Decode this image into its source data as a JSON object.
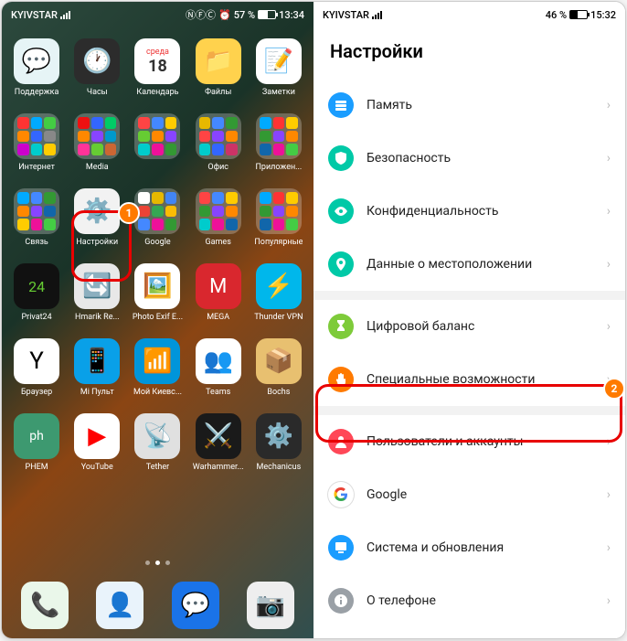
{
  "left": {
    "status": {
      "carrier": "KYIVSTAR",
      "battery_pct": "57 %",
      "time": "13:34",
      "batfill": "57%"
    },
    "apps": [
      {
        "label": "Поддержка",
        "bg": "#e6f4f6",
        "emoji": "💬",
        "fg": "#3ab"
      },
      {
        "label": "Часы",
        "bg": "#2c2c2c",
        "emoji": "🕐"
      },
      {
        "label": "Календарь",
        "type": "cal",
        "day": "18",
        "weekday": "среда"
      },
      {
        "label": "Файлы",
        "bg": "#ffd24d",
        "emoji": "📁"
      },
      {
        "label": "Заметки",
        "bg": "#fff",
        "emoji": "📝",
        "fg": "#f4c430"
      },
      {
        "label": "Интернет",
        "type": "folder",
        "c": [
          "#f33",
          "#0af",
          "#4c4",
          "#f80",
          "#36f",
          "#888",
          "#c0c",
          "#0cc",
          "#fc0"
        ]
      },
      {
        "label": "Media",
        "type": "folder",
        "c": [
          "#e11",
          "#36f",
          "#0c6",
          "#f80",
          "#84f",
          "#09c",
          "#f39",
          "#6c3",
          "#c63"
        ]
      },
      {
        "label": "",
        "type": "folder",
        "c": [
          "#f44",
          "#48f",
          "#fc0",
          "#6c3",
          "#f80",
          "#84f",
          "#0cc",
          "#e19",
          "#393"
        ]
      },
      {
        "label": "Офис",
        "type": "folder",
        "c": [
          "#e6b800",
          "#48f",
          "#393",
          "#f44",
          "#84f",
          "#f80",
          "#0cc",
          "#36f",
          "#c36"
        ]
      },
      {
        "label": "Приложен...",
        "type": "folder",
        "c": [
          "#0af",
          "#f33",
          "#fc0",
          "#393",
          "#84f",
          "#f80",
          "#16a",
          "#e19",
          "#4c4"
        ]
      },
      {
        "label": "Связь",
        "type": "folder",
        "c": [
          "#0af",
          "#48f",
          "#393",
          "#f80",
          "#84f",
          "#16a",
          "#fc0",
          "#e19",
          "#4c4"
        ]
      },
      {
        "label": "Настройки",
        "bg": "#f2f2f2",
        "emoji": "⚙️",
        "fg": "#888"
      },
      {
        "label": "Google",
        "type": "folder",
        "c": [
          "#fff",
          "#e6b800",
          "#4285f4",
          "#ea4335",
          "#34a853",
          "#fbbc05",
          "#48f",
          "#e19",
          "#393"
        ]
      },
      {
        "label": "Games",
        "type": "folder",
        "c": [
          "#f44",
          "#48f",
          "#fc0",
          "#393",
          "#84f",
          "#f80",
          "#0cc",
          "#e19",
          "#16a"
        ]
      },
      {
        "label": "Популярные",
        "type": "folder",
        "c": [
          "#0af",
          "#f33",
          "#fc0",
          "#393",
          "#84f",
          "#f80",
          "#16a",
          "#e19",
          "#4c4"
        ]
      },
      {
        "label": "Privat24",
        "bg": "#111",
        "emoji": "24",
        "fg": "#6c3",
        "fs": "16px"
      },
      {
        "label": "Hmarik Re...",
        "bg": "#e8e8e8",
        "emoji": "🔄",
        "fg": "#e80"
      },
      {
        "label": "Photo Exif E...",
        "bg": "#fff",
        "emoji": "🖼️"
      },
      {
        "label": "MEGA",
        "bg": "#d9272e",
        "emoji": "M",
        "fs": "22px"
      },
      {
        "label": "Thunder VPN",
        "bg": "#00b7eb",
        "emoji": "⚡"
      },
      {
        "label": "Браузер",
        "bg": "#fff",
        "emoji": "Y",
        "fg": "#000",
        "fs": "26px"
      },
      {
        "label": "Mi Пульт",
        "bg": "#09a0e8",
        "emoji": "📱"
      },
      {
        "label": "Мой Киевс...",
        "bg": "#0095da",
        "emoji": "📶"
      },
      {
        "label": "Teams",
        "bg": "#fff",
        "emoji": "👥",
        "fg": "#5059c9"
      },
      {
        "label": "Bochs",
        "bg": "#e8c070",
        "emoji": "📦"
      },
      {
        "label": "PHEM",
        "bg": "#3d9970",
        "emoji": "ph",
        "fs": "14px"
      },
      {
        "label": "YouTube",
        "bg": "#fff",
        "emoji": "▶",
        "fg": "#f00"
      },
      {
        "label": "Tether",
        "bg": "#e0e0e0",
        "emoji": "📡",
        "fg": "#11a"
      },
      {
        "label": "Warhammer...",
        "bg": "#1a1a1a",
        "emoji": "⚔️"
      },
      {
        "label": "Mechanicus",
        "bg": "#2a2a2a",
        "emoji": "⚙️",
        "fg": "#c96"
      }
    ],
    "dock": [
      {
        "bg": "#eaf7ea",
        "emoji": "📞",
        "fg": "#4caf50"
      },
      {
        "bg": "#e9f3fb",
        "emoji": "👤",
        "fg": "#2196f3"
      },
      {
        "bg": "#1a73e8",
        "emoji": "💬"
      },
      {
        "bg": "#eee",
        "emoji": "📷",
        "fg": "#555"
      }
    ]
  },
  "right": {
    "status": {
      "carrier": "KYIVSTAR",
      "battery_pct": "46 %",
      "time": "15:32",
      "batfill": "46%"
    },
    "title": "Настройки",
    "items": [
      {
        "label": "Память",
        "color": "#1a9dff",
        "icon": "storage"
      },
      {
        "label": "Безопасность",
        "color": "#00c9a7",
        "icon": "shield"
      },
      {
        "label": "Конфиденциальность",
        "color": "#00c9a7",
        "icon": "eye"
      },
      {
        "label": "Данные о местоположении",
        "color": "#00c9a7",
        "icon": "pin"
      },
      {
        "gap": true
      },
      {
        "label": "Цифровой баланс",
        "color": "#7ecb3a",
        "icon": "hourglass"
      },
      {
        "label": "Специальные возможности",
        "color": "#ff7a00",
        "icon": "hand"
      },
      {
        "gap": true
      },
      {
        "label": "Пользователи и аккаунты",
        "color": "#ff4757",
        "icon": "user"
      },
      {
        "label": "Google",
        "color": "#ffffff",
        "icon": "google",
        "mc": true
      },
      {
        "label": "Система и обновления",
        "color": "#1a9dff",
        "icon": "system"
      },
      {
        "label": "О телефоне",
        "color": "#9aa0a6",
        "icon": "info"
      }
    ]
  },
  "markers": {
    "m1": "1",
    "m2": "2"
  }
}
